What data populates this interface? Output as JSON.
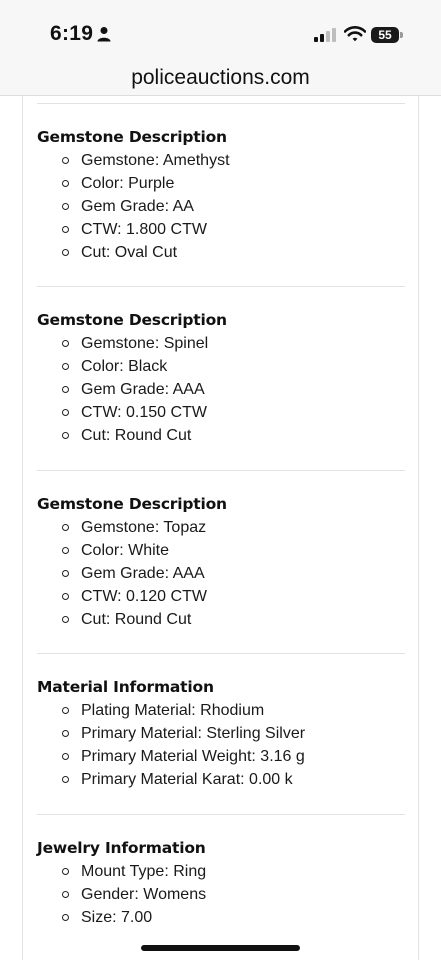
{
  "status_bar": {
    "time": "6:19",
    "battery_level": "55"
  },
  "url_bar": {
    "domain": "policeauctions.com"
  },
  "sections": [
    {
      "title": "Gemstone Description",
      "items": [
        "Gemstone: Amethyst",
        "Color: Purple",
        "Gem Grade: AA",
        "CTW: 1.800 CTW",
        "Cut: Oval Cut"
      ]
    },
    {
      "title": "Gemstone Description",
      "items": [
        "Gemstone: Spinel",
        "Color: Black",
        "Gem Grade: AAA",
        "CTW: 0.150 CTW",
        "Cut: Round Cut"
      ]
    },
    {
      "title": "Gemstone Description",
      "items": [
        "Gemstone: Topaz",
        "Color: White",
        "Gem Grade: AAA",
        "CTW: 0.120 CTW",
        "Cut: Round Cut"
      ]
    },
    {
      "title": "Material Information",
      "items": [
        "Plating Material: Rhodium",
        "Primary Material: Sterling Silver",
        "Primary Material Weight: 3.16 g",
        "Primary Material Karat: 0.00 k"
      ]
    },
    {
      "title": "Jewelry Information",
      "items": [
        "Mount Type: Ring",
        "Gender: Womens",
        "Size: 7.00"
      ]
    }
  ]
}
